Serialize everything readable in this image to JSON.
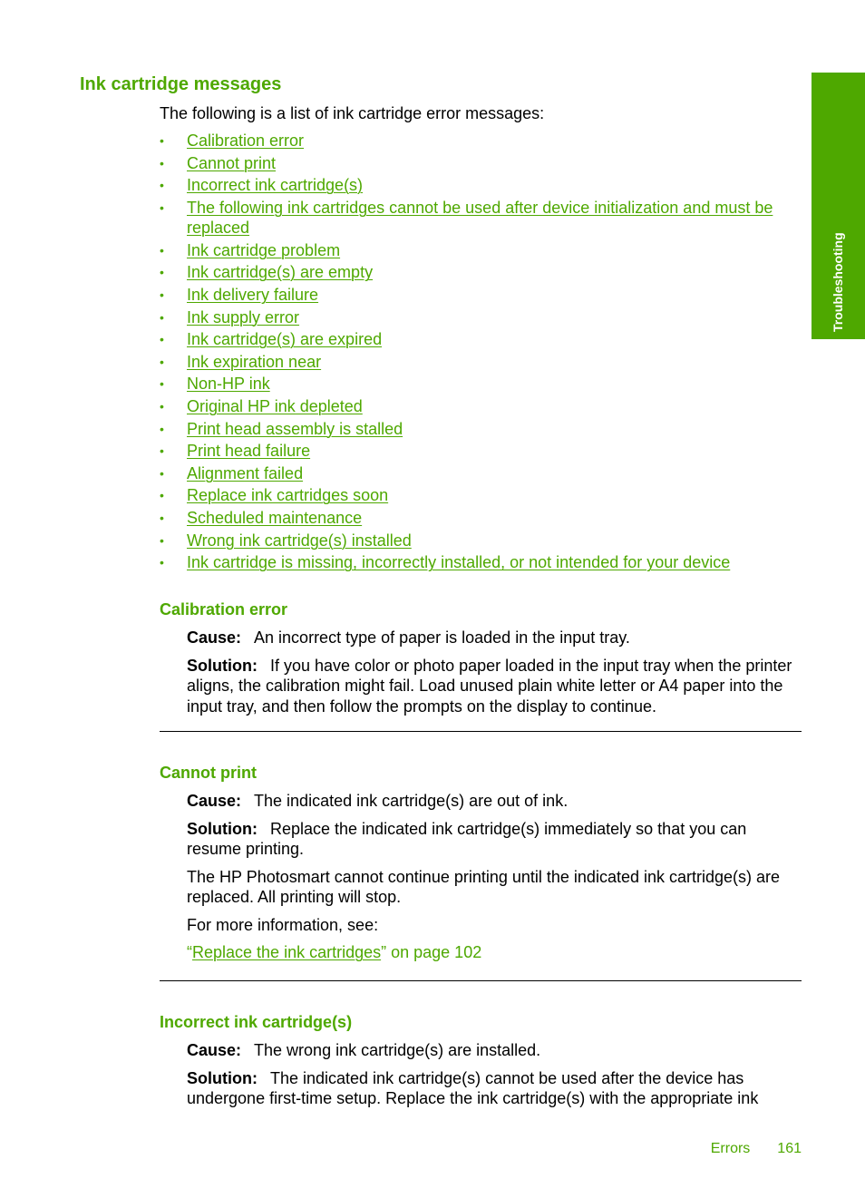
{
  "side_tab": {
    "label": "Troubleshooting"
  },
  "page": {
    "title": "Ink cartridge messages",
    "intro": "The following is a list of ink cartridge error messages:"
  },
  "toc": [
    "Calibration error",
    "Cannot print",
    "Incorrect ink cartridge(s)",
    "The following ink cartridges cannot be used after device initialization and must be replaced",
    "Ink cartridge problem",
    "Ink cartridge(s) are empty",
    "Ink delivery failure",
    "Ink supply error",
    "Ink cartridge(s) are expired",
    "Ink expiration near",
    "Non-HP ink",
    "Original HP ink depleted",
    "Print head assembly is stalled",
    "Print head failure",
    "Alignment failed",
    "Replace ink cartridges soon",
    "Scheduled maintenance",
    "Wrong ink cartridge(s) installed",
    "Ink cartridge is missing, incorrectly installed, or not intended for your device"
  ],
  "bullet_glyph": "•",
  "labels": {
    "cause": "Cause:",
    "solution": "Solution:"
  },
  "sections": {
    "calibration": {
      "heading": "Calibration error",
      "cause": "An incorrect type of paper is loaded in the input tray.",
      "solution": "If you have color or photo paper loaded in the input tray when the printer aligns, the calibration might fail. Load unused plain white letter or A4 paper into the input tray, and then follow the prompts on the display to continue."
    },
    "cannot_print": {
      "heading": "Cannot print",
      "cause": "The indicated ink cartridge(s) are out of ink.",
      "solution": "Replace the indicated ink cartridge(s) immediately so that you can resume printing.",
      "paragraph": "The HP Photosmart cannot continue printing until the indicated ink cartridge(s) are replaced. All printing will stop.",
      "more_info": "For more information, see:",
      "xref": {
        "open_quote": "“",
        "link_text": "Replace the ink cartridges",
        "close_quote": "”",
        "suffix": " on page 102"
      }
    },
    "incorrect": {
      "heading": "Incorrect ink cartridge(s)",
      "cause": "The wrong ink cartridge(s) are installed.",
      "solution": "The indicated ink cartridge(s) cannot be used after the device has undergone first-time setup. Replace the ink cartridge(s) with the appropriate ink"
    }
  },
  "footer": {
    "section": "Errors",
    "page_number": "161"
  },
  "colors": {
    "accent_green": "#4ea800",
    "text": "#000000",
    "tab_text": "#ffffff"
  }
}
